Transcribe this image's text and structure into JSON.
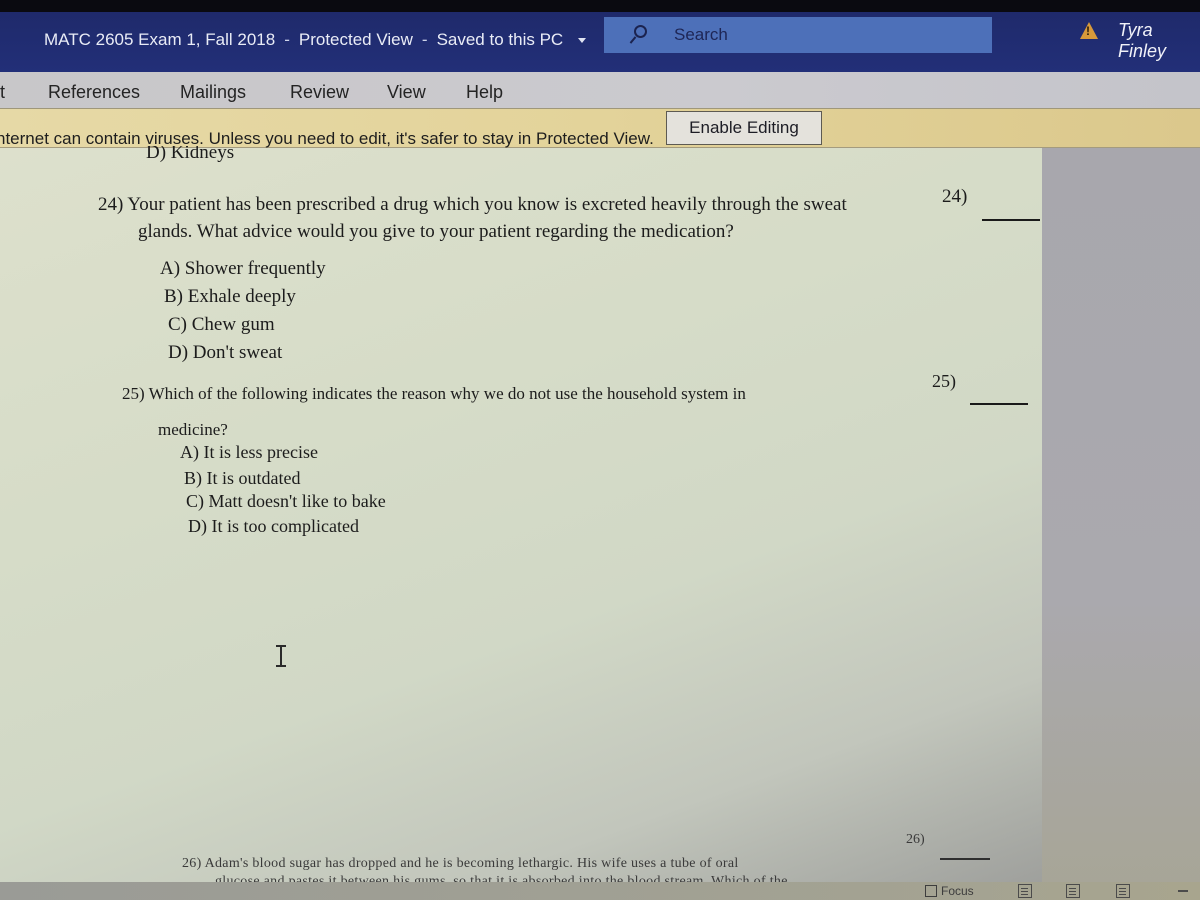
{
  "titlebar": {
    "document_name": "MATC 2605 Exam 1, Fall 2018",
    "separator": "-",
    "mode": "Protected View",
    "save_status": "Saved to this PC",
    "search_label": "Search",
    "user_name": "Tyra Finley",
    "warning_icon": "warning-triangle-icon"
  },
  "ribbon": {
    "tabs": [
      {
        "label": "t"
      },
      {
        "label": "References"
      },
      {
        "label": "Mailings"
      },
      {
        "label": "Review"
      },
      {
        "label": "View"
      },
      {
        "label": "Help"
      }
    ]
  },
  "protected_view": {
    "message": "nternet can contain viruses. Unless you need to edit, it's safer to stay in Protected View.",
    "button_label": "Enable Editing",
    "bar_color": "#e3d39a"
  },
  "document": {
    "previous_answer_fragment": "D) Kidneys",
    "questions": [
      {
        "number": "24)",
        "lines": [
          "24) Your patient has been prescribed a drug which you know is excreted heavily through the sweat",
          "glands. What advice would you give to your patient regarding the medication?"
        ],
        "options": [
          "A) Shower frequently",
          "B) Exhale deeply",
          "C) Chew gum",
          "D) Don't sweat"
        ],
        "answer_label": "24)"
      },
      {
        "number": "25)",
        "lines": [
          "25) Which of the following indicates the reason why we do not use the household system in",
          "medicine?"
        ],
        "options": [
          "A) It is less precise",
          "B) It is outdated",
          "C) Matt doesn't like to bake",
          "D) It is too complicated"
        ],
        "answer_label": "25)"
      },
      {
        "number": "26)",
        "lines": [
          "26) Adam's blood sugar has dropped and he is becoming lethargic. His wife uses a tube of oral",
          "glucose and pastes it between his gums, so that it is absorbed into the blood stream. Which of the"
        ],
        "options": [],
        "answer_label": "26)"
      }
    ]
  },
  "status_bar": {
    "focus_label": "Focus",
    "view_buttons": [
      "read-mode-icon",
      "print-layout-icon",
      "web-layout-icon"
    ]
  }
}
